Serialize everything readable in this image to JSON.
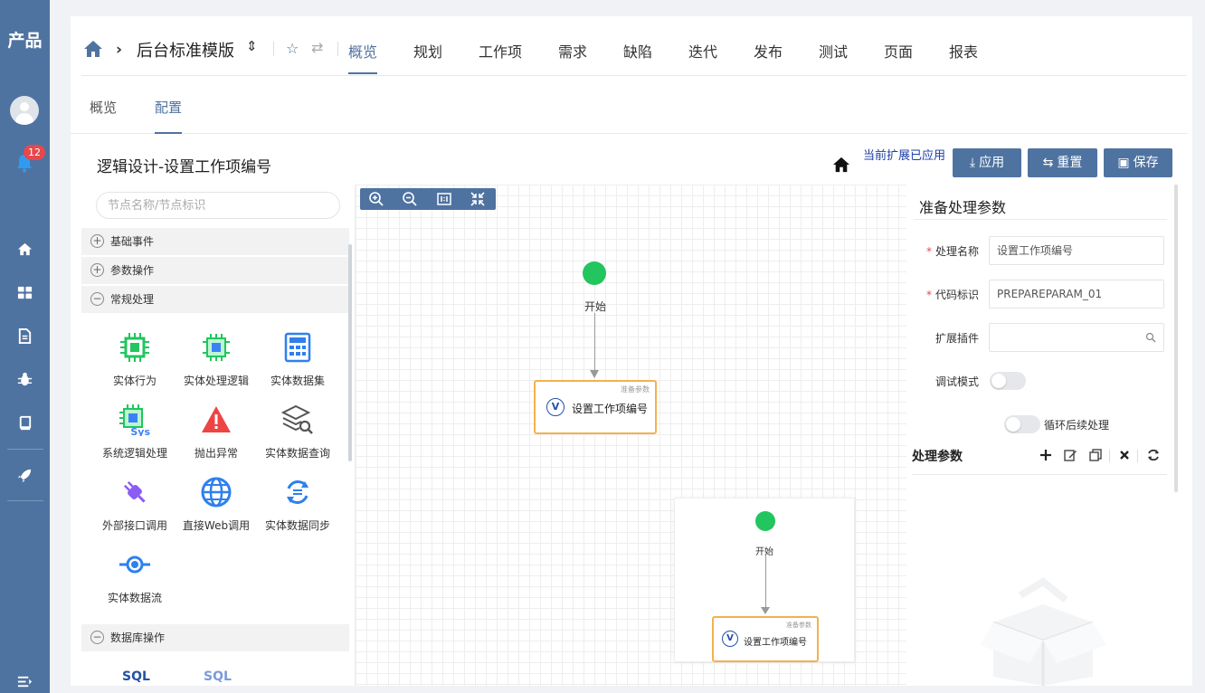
{
  "rail": {
    "brand": "产品",
    "notification_count": "12"
  },
  "topnav": {
    "project": "后台标准模版",
    "tabs": [
      "概览",
      "规划",
      "工作项",
      "需求",
      "缺陷",
      "迭代",
      "发布",
      "测试",
      "页面",
      "报表"
    ],
    "active_tab": "概览"
  },
  "subnav": {
    "tabs": [
      "概览",
      "配置"
    ],
    "active_tab": "配置"
  },
  "header": {
    "title": "逻辑设计-设置工作项编号",
    "status": "当前扩展已应用",
    "apply_label": "应用",
    "reset_label": "重置",
    "save_label": "保存"
  },
  "palette": {
    "search_placeholder": "节点名称/节点标识",
    "categories": [
      "基础事件",
      "参数操作",
      "常规处理",
      "数据库操作"
    ],
    "items": [
      "实体行为",
      "实体处理逻辑",
      "实体数据集",
      "系统逻辑处理",
      "抛出异常",
      "实体数据查询",
      "外部接口调用",
      "直接Web调用",
      "实体数据同步",
      "实体数据流"
    ],
    "sys_tag": "Sys",
    "db_items": [
      "SQL",
      "SQL"
    ]
  },
  "canvas": {
    "start_label": "开始",
    "task_tag": "准备参数",
    "task_label": "设置工作项编号",
    "task_icon": "V"
  },
  "props": {
    "heading": "准备处理参数",
    "fields": {
      "name_label": "处理名称",
      "name_value": "设置工作项编号",
      "code_label": "代码标识",
      "code_value": "PREPAREPARAM_01",
      "plugin_label": "扩展插件",
      "plugin_value": "",
      "debug_label": "调试模式",
      "loop_label": "循环后续处理"
    },
    "params_title": "处理参数"
  },
  "colors": {
    "primary": "#4f73a0",
    "start_node": "#22c55e",
    "task_border": "#f3b14f",
    "badge": "#e5484d",
    "link": "#1b3fa6"
  }
}
